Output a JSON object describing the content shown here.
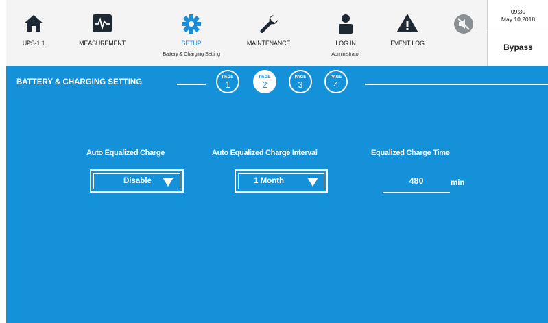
{
  "toolbar": {
    "items": [
      {
        "label": "UPS-1.1",
        "icon": "home-icon"
      },
      {
        "label": "MEASUREMENT",
        "icon": "waveform-icon"
      },
      {
        "label": "SETUP",
        "sub": "Battery & Charging Setting",
        "icon": "gear-icon",
        "active": true
      },
      {
        "label": "MAINTENANCE",
        "icon": "wrench-icon"
      },
      {
        "label": "LOG IN",
        "sub": "Administrator",
        "icon": "user-icon"
      },
      {
        "label": "EVENT LOG",
        "icon": "warning-icon"
      }
    ],
    "mute_icon": "mute-icon"
  },
  "status": {
    "time": "09:30",
    "date": "May 10,2018",
    "mode": "Bypass"
  },
  "section": {
    "title": "BATTERY & CHARGING SETTING",
    "page_word": "PAGE",
    "pages": [
      "1",
      "2",
      "3",
      "4"
    ],
    "active_page": "2"
  },
  "fields": {
    "auto_eq_charge": {
      "label": "Auto Equalized Charge",
      "value": "Disable"
    },
    "auto_eq_interval": {
      "label": "Auto Equalized Charge Interval",
      "value": "1 Month"
    },
    "eq_charge_time": {
      "label": "Equalized Charge Time",
      "value": "480",
      "unit": "min"
    }
  },
  "colors": {
    "accent_blue": "#1591da",
    "toolbar_bg": "#f4f4f4",
    "icon_dark": "#1f2933",
    "active_icon": "#1a8fd8"
  }
}
